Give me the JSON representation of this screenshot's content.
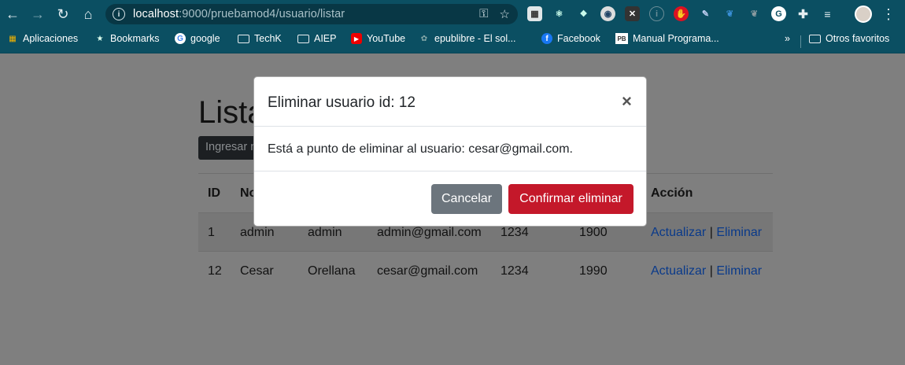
{
  "browser": {
    "url_host": "localhost",
    "url_path": ":9000/pruebamod4/usuario/listar"
  },
  "bookmarks": [
    {
      "label": "Aplicaciones",
      "icon": "apps-grid-icon"
    },
    {
      "label": "Bookmarks",
      "icon": "star-icon"
    },
    {
      "label": "google",
      "icon": "google-icon"
    },
    {
      "label": "TechK",
      "icon": "folder-icon"
    },
    {
      "label": "AIEP",
      "icon": "folder-icon"
    },
    {
      "label": "YouTube",
      "icon": "youtube-icon"
    },
    {
      "label": "epublibre - El sol...",
      "icon": "epublibre-icon"
    },
    {
      "label": "Facebook",
      "icon": "facebook-icon"
    },
    {
      "label": "Manual Programa...",
      "icon": "pb-icon"
    },
    {
      "label": "Otros favoritos",
      "icon": "folder-icon"
    }
  ],
  "page": {
    "heading": "Lista",
    "add_button": "Ingresar n",
    "table": {
      "headers": [
        "ID",
        "No",
        "",
        "",
        "",
        "",
        "Acción"
      ],
      "rows": [
        {
          "id": "1",
          "nombre": "admin",
          "apellido": "admin",
          "email": "admin@gmail.com",
          "telefono": "1234",
          "anio": "1900",
          "update": "Actualizar",
          "sep": "|",
          "delete": "Eliminar"
        },
        {
          "id": "12",
          "nombre": "Cesar",
          "apellido": "Orellana",
          "email": "cesar@gmail.com",
          "telefono": "1234",
          "anio": "1990",
          "update": "Actualizar",
          "sep": "|",
          "delete": "Eliminar"
        }
      ]
    }
  },
  "modal": {
    "title": "Eliminar usuario id: 12",
    "close": "×",
    "body": "Está a punto de eliminar al usuario: cesar@gmail.com.",
    "cancel_label": "Cancelar",
    "confirm_label": "Confirmar eliminar"
  },
  "colors": {
    "chrome": "#0b4f62",
    "overlay": "#7f7f7f",
    "cancel": "#6c757d",
    "confirm": "#c4182a",
    "link": "#0a3a8a"
  }
}
